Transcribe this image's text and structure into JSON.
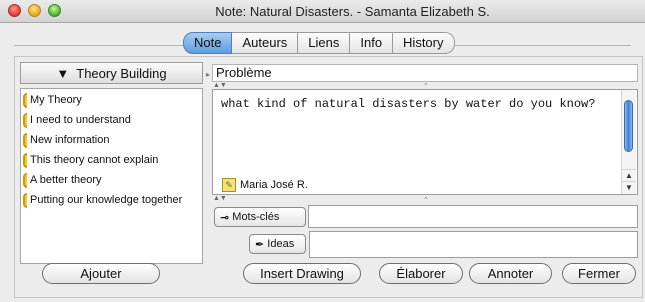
{
  "window": {
    "title": "Note: Natural Disasters.  - Samanta Elizabeth S."
  },
  "tabs": [
    {
      "label": "Note",
      "active": true
    },
    {
      "label": "Auteurs",
      "active": false
    },
    {
      "label": "Liens",
      "active": false
    },
    {
      "label": "Info",
      "active": false
    },
    {
      "label": "History",
      "active": false
    }
  ],
  "left_panel": {
    "header": "Theory Building",
    "items": [
      "My Theory",
      "I need to understand",
      "New information",
      "This theory cannot explain",
      "A better theory",
      "Putting our knowledge together"
    ],
    "add_button": "Ajouter"
  },
  "note": {
    "title_field": "Problème",
    "body": "what kind of natural disasters by water do you know?",
    "author": "Maria José R.",
    "keywords_button": "Mots-clés",
    "ideas_button": "Ideas"
  },
  "bottom_buttons": {
    "insert_drawing": "Insert Drawing",
    "elaborer": "Élaborer",
    "annoter": "Annoter",
    "fermer": "Fermer"
  },
  "colors": {
    "scaffold": "#f5c830",
    "active_tab": "#5e9ae0"
  }
}
